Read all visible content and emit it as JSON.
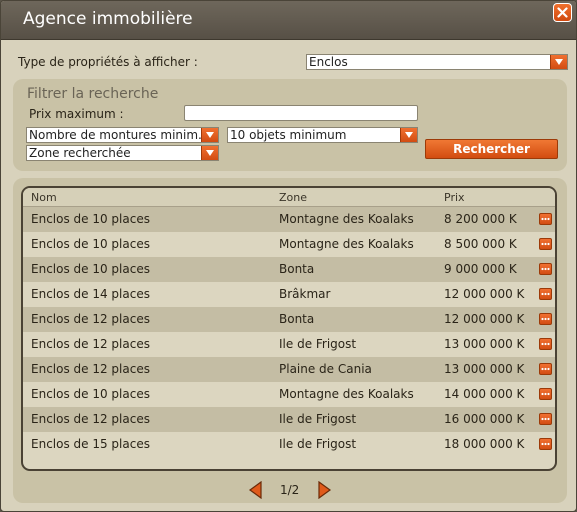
{
  "window": {
    "title": "Agence immobilière"
  },
  "property_type": {
    "label": "Type de propriétés à afficher :",
    "selected": "Enclos"
  },
  "filter": {
    "title": "Filtrer la recherche",
    "max_price_label": "Prix maximum :",
    "max_price_value": "",
    "mounts_select": "Nombre de montures minim...",
    "objects_select": "10 objets minimum",
    "zone_select": "Zone recherchée",
    "search_button": "Rechercher"
  },
  "table": {
    "headers": {
      "name": "Nom",
      "zone": "Zone",
      "price": "Prix"
    },
    "rows": [
      {
        "name": "Enclos de 10 places",
        "zone": "Montagne des Koalaks",
        "price": "8 200 000 K"
      },
      {
        "name": "Enclos de 10 places",
        "zone": "Montagne des Koalaks",
        "price": "8 500 000 K"
      },
      {
        "name": "Enclos de 10 places",
        "zone": "Bonta",
        "price": "9 000 000 K"
      },
      {
        "name": "Enclos de 14 places",
        "zone": "Brâkmar",
        "price": "12 000 000 K"
      },
      {
        "name": "Enclos de 12 places",
        "zone": "Bonta",
        "price": "12 000 000 K"
      },
      {
        "name": "Enclos de 12 places",
        "zone": "Ile de Frigost",
        "price": "13 000 000 K"
      },
      {
        "name": "Enclos de 12 places",
        "zone": "Plaine de Cania",
        "price": "13 000 000 K"
      },
      {
        "name": "Enclos de 10 places",
        "zone": "Montagne des Koalaks",
        "price": "14 000 000 K"
      },
      {
        "name": "Enclos de 12 places",
        "zone": "Ile de Frigost",
        "price": "16 000 000 K"
      },
      {
        "name": "Enclos de 15 places",
        "zone": "Ile de Frigost",
        "price": "18 000 000 K"
      }
    ]
  },
  "pager": {
    "text": "1/2"
  },
  "colors": {
    "accent": "#e05a1a",
    "panel": "#c9c2a6",
    "titlebar": "#5f584c"
  },
  "icons": {
    "close": "close-icon",
    "dropdown": "chevron-down-icon",
    "row_action": "more-icon",
    "prev": "arrow-left-icon",
    "next": "arrow-right-icon"
  }
}
